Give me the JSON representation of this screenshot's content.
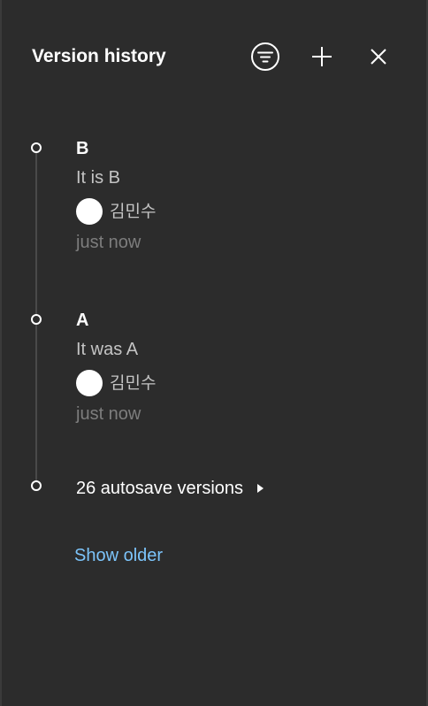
{
  "header": {
    "title": "Version history",
    "filter_icon": "filter-icon",
    "add_icon": "plus-icon",
    "close_icon": "close-icon"
  },
  "versions": [
    {
      "name": "B",
      "description": "It is B",
      "user": "김민수",
      "time": "just now"
    },
    {
      "name": "A",
      "description": "It was A",
      "user": "김민수",
      "time": "just now"
    }
  ],
  "autosave": {
    "label": "26 autosave versions"
  },
  "footer": {
    "show_older": "Show older"
  },
  "colors": {
    "background": "#2c2c2c",
    "text_primary": "#ffffff",
    "text_secondary": "#c4c4c4",
    "text_muted": "#7d7d7d",
    "link": "#7cc4fa"
  }
}
